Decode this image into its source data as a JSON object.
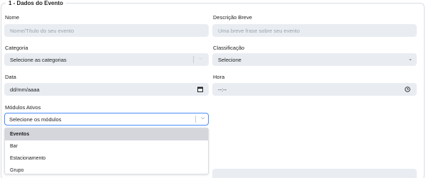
{
  "section": {
    "legend": "1 - Dados do Evento"
  },
  "fields": {
    "nome": {
      "label": "Nome",
      "placeholder": "Nome/Título do seu evento"
    },
    "descricao": {
      "label": "Descrição Breve",
      "placeholder": "Uma breve frase sobre seu evento"
    },
    "categoria": {
      "label": "Categoria",
      "value": "Selecione as categorias"
    },
    "classificacao": {
      "label": "Classificação",
      "value": "Selecione"
    },
    "data": {
      "label": "Data",
      "value": "dd/mm/aaaa"
    },
    "hora": {
      "label": "Hora",
      "value": "--:--"
    },
    "modulos": {
      "label": "Módulos Ativos",
      "value": "Selecione os módulos",
      "options": [
        "Eventos",
        "Bar",
        "Estacionamento",
        "Grupo"
      ],
      "highlighted": "Eventos"
    }
  },
  "icons": {
    "select_chevron": "chevron-down-icon",
    "date": "calendar-icon",
    "time": "clock-icon"
  },
  "colors": {
    "input_bg": "#e9edf2",
    "focus_border": "#4a8cf7",
    "highlight_bg": "#d4d6dc"
  }
}
